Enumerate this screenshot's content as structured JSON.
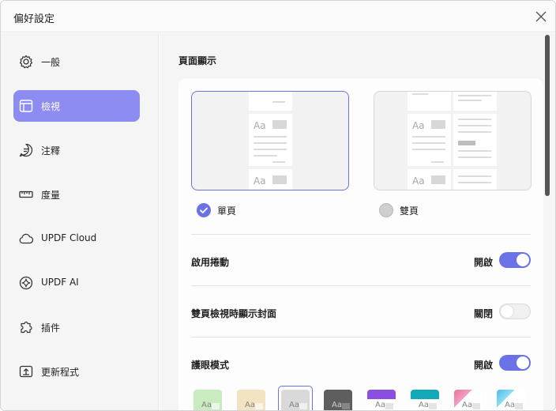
{
  "window": {
    "title": "偏好設定"
  },
  "sidebar": {
    "items": [
      {
        "label": "一般",
        "icon": "gear-icon"
      },
      {
        "label": "檢視",
        "icon": "layout-icon",
        "active": true
      },
      {
        "label": "注釋",
        "icon": "comment-icon"
      },
      {
        "label": "度量",
        "icon": "ruler-icon"
      },
      {
        "label": "UPDF Cloud",
        "icon": "cloud-icon"
      },
      {
        "label": "UPDF AI",
        "icon": "ai-sparkle-icon"
      },
      {
        "label": "插件",
        "icon": "puzzle-icon"
      },
      {
        "label": "更新程式",
        "icon": "update-icon"
      }
    ]
  },
  "main": {
    "section_title": "頁面顯示",
    "page_layout": {
      "single_label": "單頁",
      "double_label": "雙頁",
      "selected": "single"
    },
    "settings": [
      {
        "label": "啟用捲動",
        "state_label": "開啟",
        "on": true
      },
      {
        "label": "雙頁檢視時顯示封面",
        "state_label": "關閉",
        "on": false
      },
      {
        "label": "護眼模式",
        "state_label": "開啟",
        "on": true
      }
    ],
    "themes": [
      {
        "name": "light-green",
        "color": "#c8ecc0"
      },
      {
        "name": "beige",
        "color": "#f2e3c2"
      },
      {
        "name": "light-gray",
        "color": "#d9d9d9",
        "selected": true
      },
      {
        "name": "dark-gray",
        "color": "#5e5e5e"
      },
      {
        "name": "purple",
        "color": "#8a4fe0"
      },
      {
        "name": "teal",
        "color": "#12a8b8"
      },
      {
        "name": "pink-gradient",
        "color": "#f08ab0"
      },
      {
        "name": "blue-gradient",
        "color": "#6cc8f0"
      }
    ],
    "theme_sample_label": "Aa"
  },
  "colors": {
    "accent": "#6b72e8",
    "sidebar_active": "#8c8cf2"
  }
}
